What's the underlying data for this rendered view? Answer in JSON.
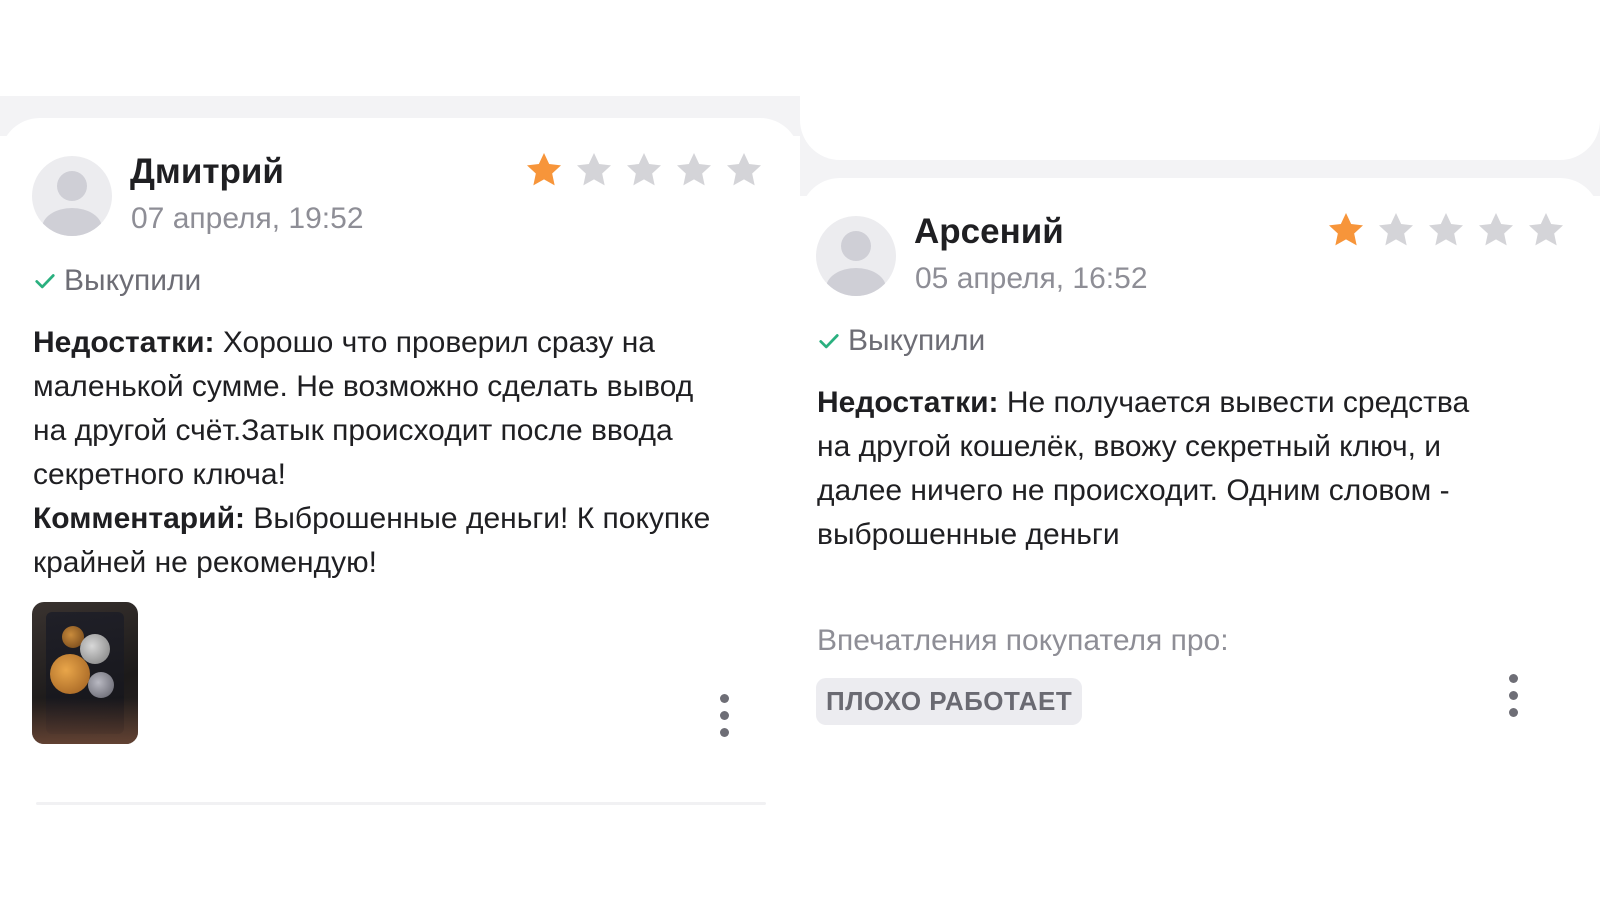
{
  "colors": {
    "star_active": "#f7953a",
    "star_inactive": "#d4d4d8",
    "check": "#2ab07f",
    "muted_text": "#8e8e96"
  },
  "reviews": [
    {
      "author": "Дмитрий",
      "date": "07 апреля, 19:52",
      "rating": 1,
      "rating_max": 5,
      "status": "Выкупили",
      "status_icon": "check-icon",
      "cons_label": "Недостатки:",
      "cons_text": " Хорошо что проверил сразу на маленькой сумме. Не возможно сделать вывод на другой счёт.Затык происходит после ввода секретного ключа!",
      "comment_label": "Комментарий:",
      "comment_text": " Выброшенные деньги! К покупке крайней не рекомендую!",
      "has_photo": true,
      "photo_icon": "review-photo"
    },
    {
      "author": "Арсений",
      "date": "05 апреля, 16:52",
      "rating": 1,
      "rating_max": 5,
      "status": "Выкупили",
      "status_icon": "check-icon",
      "cons_label": "Недостатки:",
      "cons_text": " Не получается вывести средства на другой кошелёк, ввожу секретный ключ, и далее ничего не происходит. Одним словом - выброшенные деньги",
      "impressions_label": "Впечатления покупателя про:",
      "impressions_tag": "ПЛОХО РАБОТАЕТ"
    }
  ]
}
